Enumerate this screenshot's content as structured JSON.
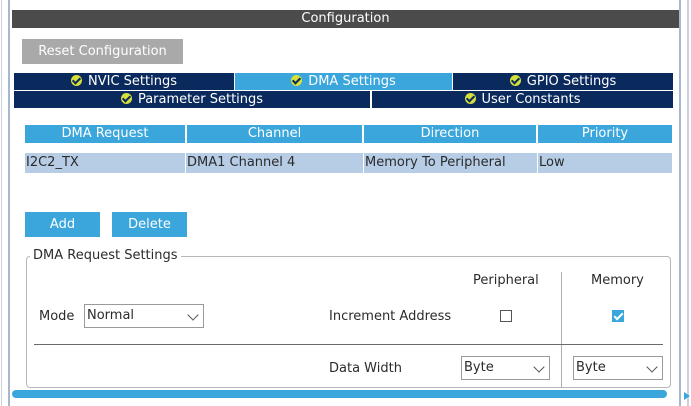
{
  "header": {
    "title": "Configuration"
  },
  "toolbar": {
    "reset_label": "Reset Configuration"
  },
  "tabs": {
    "row1": [
      {
        "label": "NVIC Settings"
      },
      {
        "label": "DMA Settings"
      },
      {
        "label": "GPIO Settings"
      }
    ],
    "row2": [
      {
        "label": "Parameter Settings"
      },
      {
        "label": "User Constants"
      }
    ]
  },
  "table": {
    "headers": [
      "DMA Request",
      "Channel",
      "Direction",
      "Priority"
    ],
    "rows": [
      [
        "I2C2_TX",
        "DMA1 Channel 4",
        "Memory To Peripheral",
        "Low"
      ]
    ]
  },
  "actions": {
    "add_label": "Add",
    "delete_label": "Delete"
  },
  "settings": {
    "group_title": "DMA Request Settings",
    "col_peripheral": "Peripheral",
    "col_memory": "Memory",
    "mode_label": "Mode",
    "mode_value": "Normal",
    "increment_label": "Increment Address",
    "increment_peripheral_checked": false,
    "increment_memory_checked": true,
    "data_width_label": "Data Width",
    "data_width_peripheral": "Byte",
    "data_width_memory": "Byte"
  },
  "colors": {
    "accent": "#3aa6dc",
    "tab_dark": "#0a2a5e",
    "selected_row": "#b7cde6",
    "title_bar": "#4b4b4b"
  }
}
